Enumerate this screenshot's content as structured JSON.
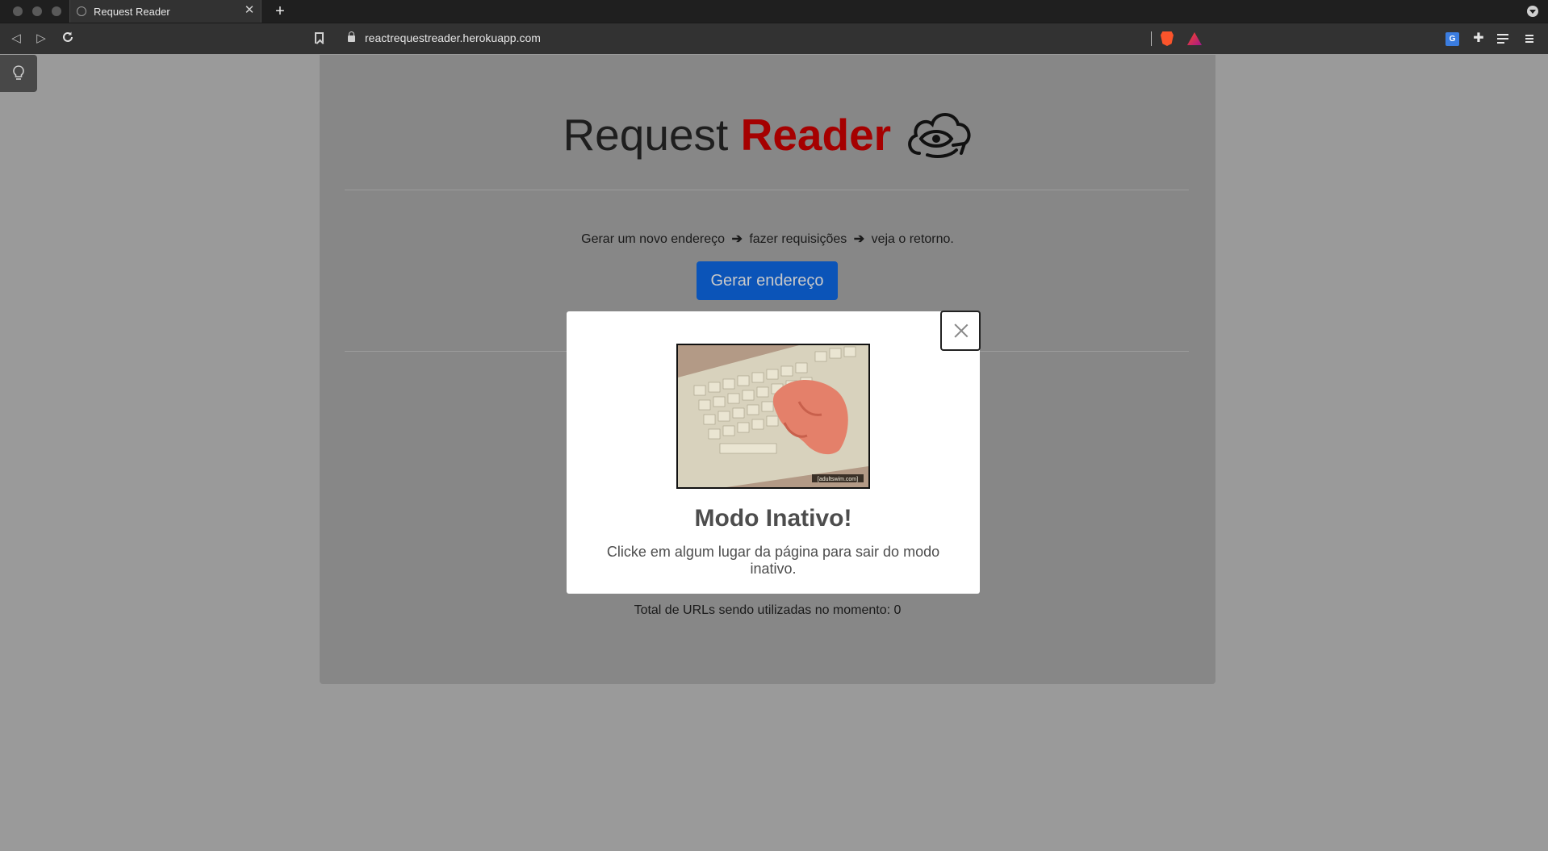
{
  "browser": {
    "tab_title": "Request Reader",
    "tab_close": "✕",
    "new_tab": "+",
    "url": "reactrequestreader.herokuapp.com",
    "icons": [
      "back-icon",
      "forward-icon",
      "reload-icon",
      "bookmark-icon",
      "lock-icon",
      "brave-shields-icon",
      "brave-rewards-icon",
      "translate-icon",
      "extensions-icon",
      "playlist-icon",
      "menu-icon"
    ]
  },
  "header": {
    "title_plain": "Request",
    "title_accent": "Reader",
    "accent_color": "#a50000"
  },
  "main": {
    "step1": "Gerar um novo endereço",
    "step2": "fazer requisições",
    "step3": "veja o retorno.",
    "arrow": "➔",
    "generate_button": "Gerar endereço",
    "button_color": "#0b54b8",
    "total_label": "Total de URLs sendo utilizadas no momento:",
    "total_count": "0"
  },
  "modal": {
    "gif_watermark": "[adultswim.com]",
    "title": "Modo Inativo!",
    "text": "Clicke em algum lugar da página para sair do modo inativo."
  }
}
